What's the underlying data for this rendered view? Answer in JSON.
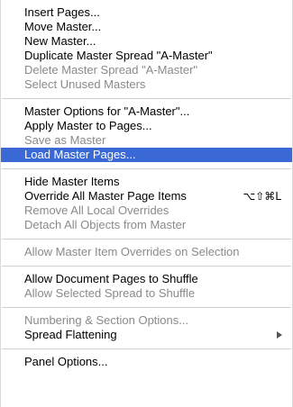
{
  "menu": {
    "groups": [
      [
        {
          "label": "Insert Pages...",
          "enabled": true
        },
        {
          "label": "Move Master...",
          "enabled": true
        },
        {
          "label": "New Master...",
          "enabled": true
        },
        {
          "label": "Duplicate Master Spread \"A-Master\"",
          "enabled": true
        },
        {
          "label": "Delete Master Spread \"A-Master\"",
          "enabled": false
        },
        {
          "label": "Select Unused Masters",
          "enabled": false
        }
      ],
      [
        {
          "label": "Master Options for \"A-Master\"...",
          "enabled": true
        },
        {
          "label": "Apply Master to Pages...",
          "enabled": true
        },
        {
          "label": "Save as Master",
          "enabled": false
        },
        {
          "label": "Load Master Pages...",
          "enabled": true,
          "highlighted": true
        }
      ],
      [
        {
          "label": "Hide Master Items",
          "enabled": true
        },
        {
          "label": "Override All Master Page Items",
          "enabled": true,
          "shortcut": "⌥⇧⌘L"
        },
        {
          "label": "Remove All Local Overrides",
          "enabled": false
        },
        {
          "label": "Detach All Objects from Master",
          "enabled": false
        }
      ],
      [
        {
          "label": "Allow Master Item Overrides on Selection",
          "enabled": false
        }
      ],
      [
        {
          "label": "Allow Document Pages to Shuffle",
          "enabled": true
        },
        {
          "label": "Allow Selected Spread to Shuffle",
          "enabled": false
        }
      ],
      [
        {
          "label": "Numbering & Section Options...",
          "enabled": false
        },
        {
          "label": "Spread Flattening",
          "enabled": true,
          "submenu": true
        }
      ],
      [
        {
          "label": "Panel Options...",
          "enabled": true
        }
      ]
    ],
    "colors": {
      "highlight": "#3a69d6",
      "disabled_text": "#8a8a8a",
      "separator": "#d0d0d0"
    }
  }
}
